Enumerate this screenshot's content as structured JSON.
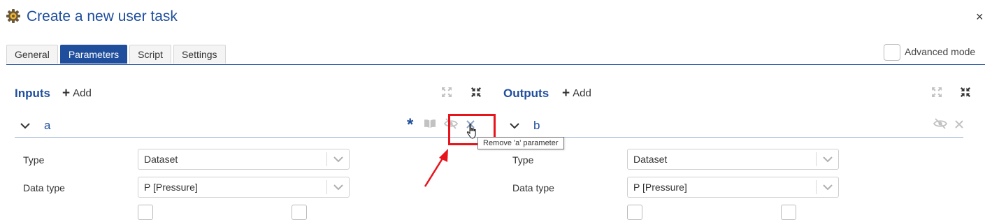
{
  "header": {
    "title": "Create a new user task",
    "close_symbol": "×",
    "icons": {
      "title": "gear-task-icon",
      "close": "close-icon"
    }
  },
  "tabs": [
    {
      "label": "General",
      "active": false
    },
    {
      "label": "Parameters",
      "active": true
    },
    {
      "label": "Script",
      "active": false
    },
    {
      "label": "Settings",
      "active": false
    }
  ],
  "advanced_mode": {
    "label": "Advanced mode",
    "checked": false
  },
  "inputs": {
    "title": "Inputs",
    "add_label": "Add",
    "param": {
      "name": "a",
      "required_symbol": "*",
      "type_label": "Type",
      "type_value": "Dataset",
      "data_type_label": "Data type",
      "data_type_value": "P [Pressure]"
    },
    "icons": [
      "plus-icon",
      "expand-all-icon",
      "collapse-all-icon",
      "chevron-down-icon",
      "required-asterisk-icon",
      "book-icon",
      "hide-eye-icon",
      "remove-icon",
      "dropdown-arrow-icon"
    ]
  },
  "outputs": {
    "title": "Outputs",
    "add_label": "Add",
    "param": {
      "name": "b",
      "type_label": "Type",
      "type_value": "Dataset",
      "data_type_label": "Data type",
      "data_type_value": "P [Pressure]"
    },
    "icons": [
      "plus-icon",
      "expand-all-icon",
      "collapse-all-icon",
      "chevron-down-icon",
      "hide-eye-icon",
      "remove-icon",
      "dropdown-arrow-icon"
    ]
  },
  "tooltip": {
    "text": "Remove 'a' parameter"
  },
  "annotation": {
    "icons": [
      "highlight-box",
      "red-arrow-icon",
      "hand-cursor-icon"
    ]
  },
  "colors": {
    "brand": "#1f4e9c",
    "highlight": "#e8141c",
    "muted_icon": "#c2c2c2"
  }
}
